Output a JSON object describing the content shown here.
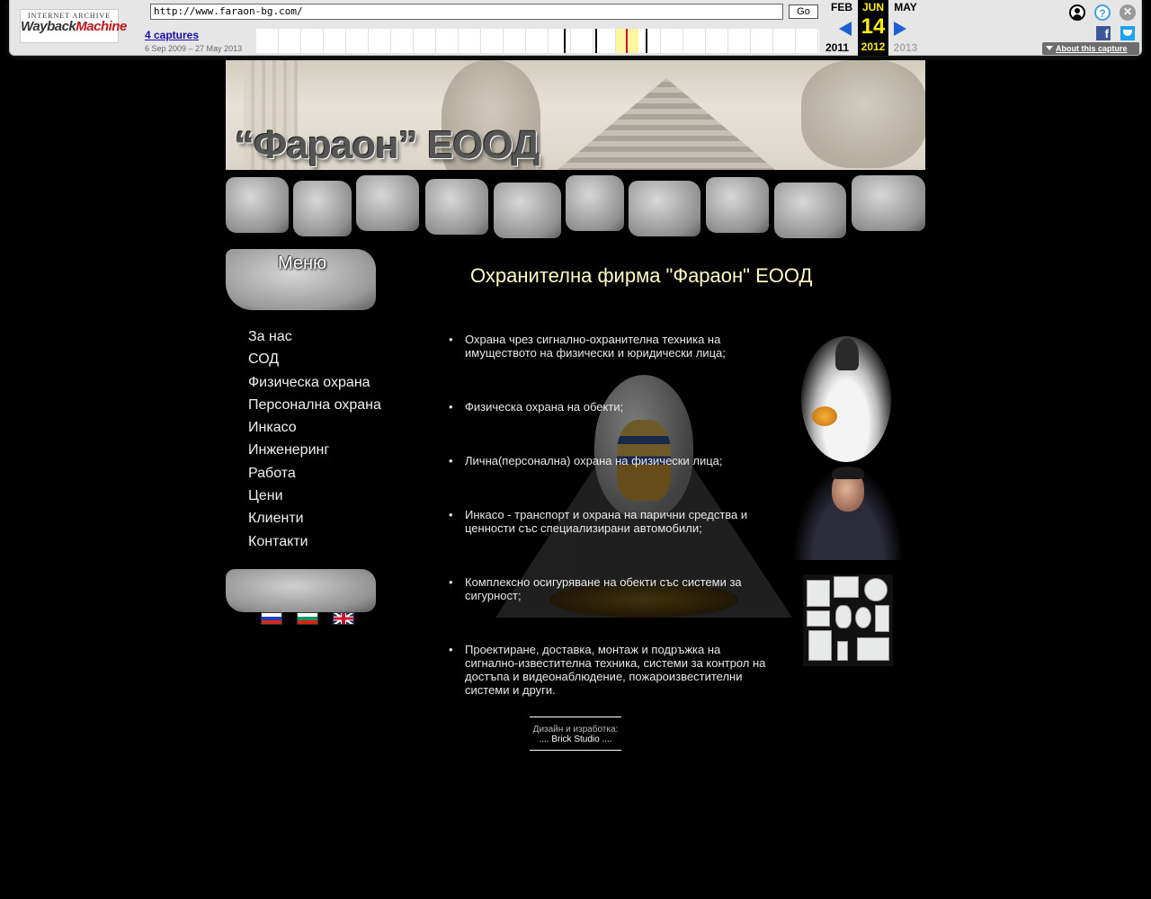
{
  "wayback": {
    "logo_top": "INTERNET ARCHIVE",
    "logo_wayback": "Wayback",
    "logo_machine": "Machine",
    "url": "http://www.faraon-bg.com/",
    "go_label": "Go",
    "captures_label": "4 captures",
    "range_label": "6 Sep 2009 – 27 May 2013",
    "prev_month": "FEB",
    "current_month": "JUN",
    "next_month": "MAY",
    "current_day": "14",
    "prev_year": "2011",
    "current_year": "2012",
    "next_year": "2013",
    "fb_letter": "f",
    "about_label": "About this capture",
    "help_glyph": "?",
    "close_glyph": "✕",
    "icons": [
      "wayback-logo",
      "user-icon",
      "help-icon",
      "close-icon",
      "facebook-icon",
      "twitter-icon",
      "prev-arrow-icon",
      "next-arrow-icon"
    ]
  },
  "site": {
    "banner_title": "“Фараон” ЕООД",
    "menu_label": "Меню",
    "page_heading": "Охранителна фирма \"Фараон\" ЕООД",
    "nav": [
      "За нас",
      "СОД",
      "Физическа охрана",
      "Персонална охрана",
      "Инкасо",
      "Инженеринг",
      "Работа",
      "Цени",
      "Клиенти",
      "Контакти"
    ],
    "services": [
      "Охрана чрез сигнално-охранителна техника на имуществото на физически и юридически лица;",
      "Физическа охрана на обекти;",
      "Лична(персонална) охрана на физически лица;",
      "Инкасо - транспорт и охрана на парични средства и ценности със специализирани автомобили;",
      "Комплексно осигуряване на обекти със системи за сигурност;",
      "Проектиране, доставка, монтаж и подръжка на сигнално-известителна техника, системи за контрол на достъпа и видеонаблюдение, пожароизвестителни системи и други."
    ],
    "footer_line1": "Дизайн и изработка:",
    "footer_line2": ".... Brick Studio ....",
    "languages": [
      "ru-flag",
      "bg-flag",
      "en-flag"
    ]
  },
  "colors": {
    "background": "#000000",
    "heading": "#fffbc4",
    "calendar_highlight": "#ffef00",
    "capture_marker": "#c8102e"
  }
}
